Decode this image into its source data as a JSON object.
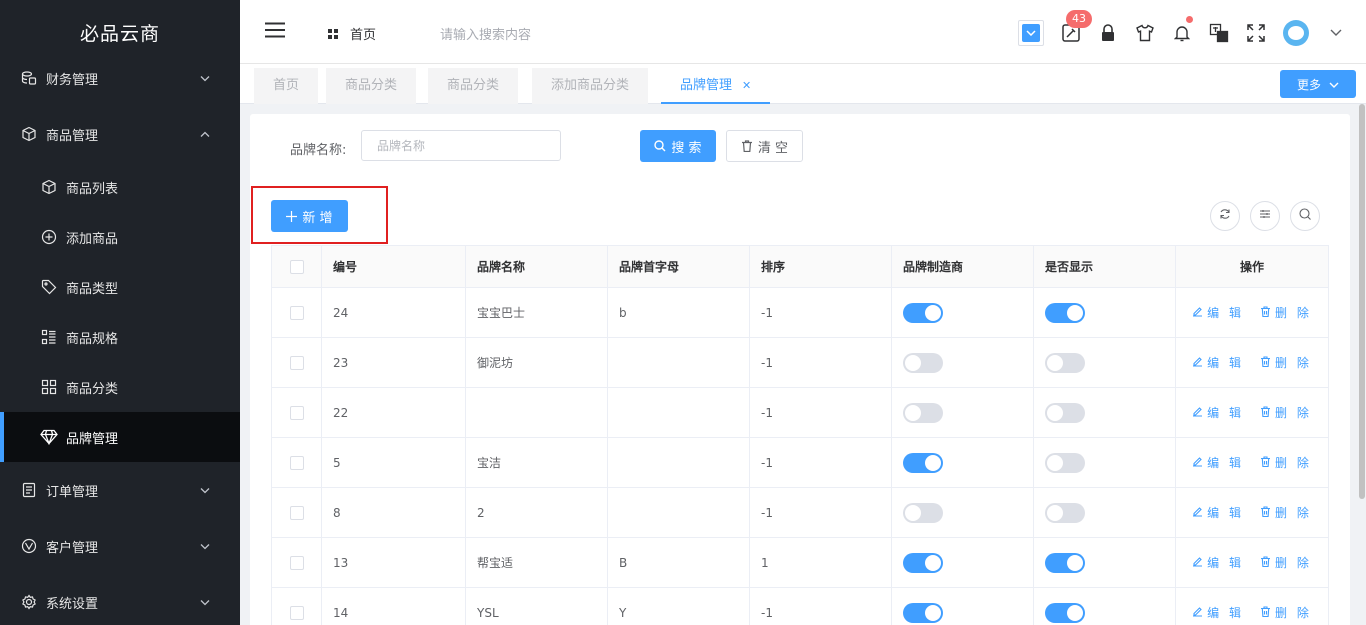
{
  "app": {
    "title": "必品云商"
  },
  "sidebar": {
    "items": [
      {
        "label": "财务管理",
        "icon": "finance-icon",
        "level": 1,
        "expandable": true
      },
      {
        "label": "商品管理",
        "icon": "box-icon",
        "level": 1,
        "expandable": true,
        "expanded": true
      },
      {
        "label": "商品列表",
        "icon": "cube-icon",
        "level": 2
      },
      {
        "label": "添加商品",
        "icon": "plus-circle-icon",
        "level": 2
      },
      {
        "label": "商品类型",
        "icon": "tag-icon",
        "level": 2
      },
      {
        "label": "商品规格",
        "icon": "spec-icon",
        "level": 2
      },
      {
        "label": "商品分类",
        "icon": "grid-icon",
        "level": 2
      },
      {
        "label": "品牌管理",
        "icon": "diamond-icon",
        "level": 2,
        "active": true
      },
      {
        "label": "订单管理",
        "icon": "document-icon",
        "level": 1,
        "expandable": true
      },
      {
        "label": "客户管理",
        "icon": "customer-icon",
        "level": 1,
        "expandable": true
      },
      {
        "label": "系统设置",
        "icon": "gear-icon",
        "level": 1,
        "expandable": true
      }
    ]
  },
  "header": {
    "home_label": "首页",
    "search_placeholder": "请输入搜索内容",
    "notification_count": "43"
  },
  "tabs": [
    {
      "label": "首页"
    },
    {
      "label": "商品分类"
    },
    {
      "label": "商品分类"
    },
    {
      "label": "添加商品分类"
    },
    {
      "label": "品牌管理",
      "active": true
    }
  ],
  "more_label": "更多",
  "search_form": {
    "label": "品牌名称:",
    "placeholder": "品牌名称",
    "search_btn": "搜 索",
    "clear_btn": "清 空"
  },
  "add_btn": "新 增",
  "table": {
    "columns": [
      "编号",
      "品牌名称",
      "品牌首字母",
      "排序",
      "品牌制造商",
      "是否显示",
      "操作"
    ],
    "edit_label": "编 辑",
    "delete_label": "删 除",
    "rows": [
      {
        "id": "24",
        "name": "宝宝巴士",
        "letter": "b",
        "sort": "-1",
        "manufacturer": true,
        "show": true
      },
      {
        "id": "23",
        "name": "御泥坊",
        "letter": "",
        "sort": "-1",
        "manufacturer": false,
        "show": false
      },
      {
        "id": "22",
        "name": "",
        "letter": "",
        "sort": "-1",
        "manufacturer": false,
        "show": false
      },
      {
        "id": "5",
        "name": "宝洁",
        "letter": "",
        "sort": "-1",
        "manufacturer": true,
        "show": false
      },
      {
        "id": "8",
        "name": "2",
        "letter": "",
        "sort": "-1",
        "manufacturer": false,
        "show": false
      },
      {
        "id": "13",
        "name": "帮宝适",
        "letter": "B",
        "sort": "1",
        "manufacturer": true,
        "show": true
      },
      {
        "id": "14",
        "name": "YSL",
        "letter": "Y",
        "sort": "-1",
        "manufacturer": true,
        "show": true
      }
    ]
  },
  "colors": {
    "primary": "#409eff",
    "sidebar_bg": "#1f2329",
    "highlight_border": "#e02020"
  }
}
